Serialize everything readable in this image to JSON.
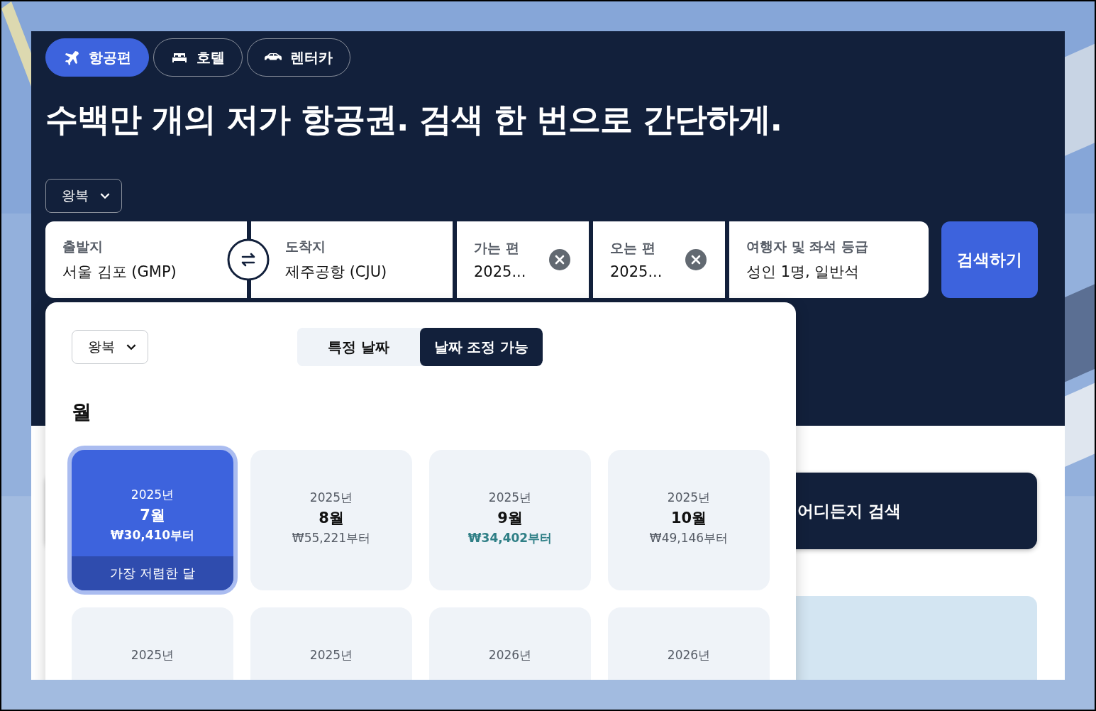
{
  "tabs": [
    {
      "label": "항공편",
      "selected": true
    },
    {
      "label": "호텔",
      "selected": false
    },
    {
      "label": "렌터카",
      "selected": false
    }
  ],
  "headline": "수백만 개의 저가 항공권. 검색 한 번으로 간단하게.",
  "trip_type": "왕복",
  "search": {
    "origin": {
      "label": "출발지",
      "value": "서울 김포 (GMP)"
    },
    "destination": {
      "label": "도착지",
      "value": "제주공항 (CJU)"
    },
    "dates": [
      {
        "label": "가는 편",
        "value": "2025..."
      },
      {
        "label": "오는 편",
        "value": "2025..."
      }
    ],
    "travellers": {
      "label": "여행자 및 좌석 등급",
      "value": "성인 1명, 일반석"
    },
    "button": "검색하기"
  },
  "anywhere_button": "어디든지 검색",
  "date_popup": {
    "trip_type": "왕복",
    "modes": [
      {
        "label": "특정 날짜",
        "selected": false
      },
      {
        "label": "날짜 조정 가능",
        "selected": true
      }
    ],
    "heading": "월",
    "months": [
      {
        "year": "2025년",
        "month": "7월",
        "price": "₩30,410부터",
        "selected": true,
        "cheapest": true,
        "badge": "가장 저렴한 달"
      },
      {
        "year": "2025년",
        "month": "8월",
        "price": "₩55,221부터",
        "selected": false,
        "cheapest": false
      },
      {
        "year": "2025년",
        "month": "9월",
        "price": "₩34,402부터",
        "selected": false,
        "cheapest": true
      },
      {
        "year": "2025년",
        "month": "10월",
        "price": "₩49,146부터",
        "selected": false,
        "cheapest": false
      },
      {
        "year": "2025년",
        "selected": false
      },
      {
        "year": "2025년",
        "selected": false
      },
      {
        "year": "2026년",
        "selected": false
      },
      {
        "year": "2026년",
        "selected": false
      }
    ]
  }
}
